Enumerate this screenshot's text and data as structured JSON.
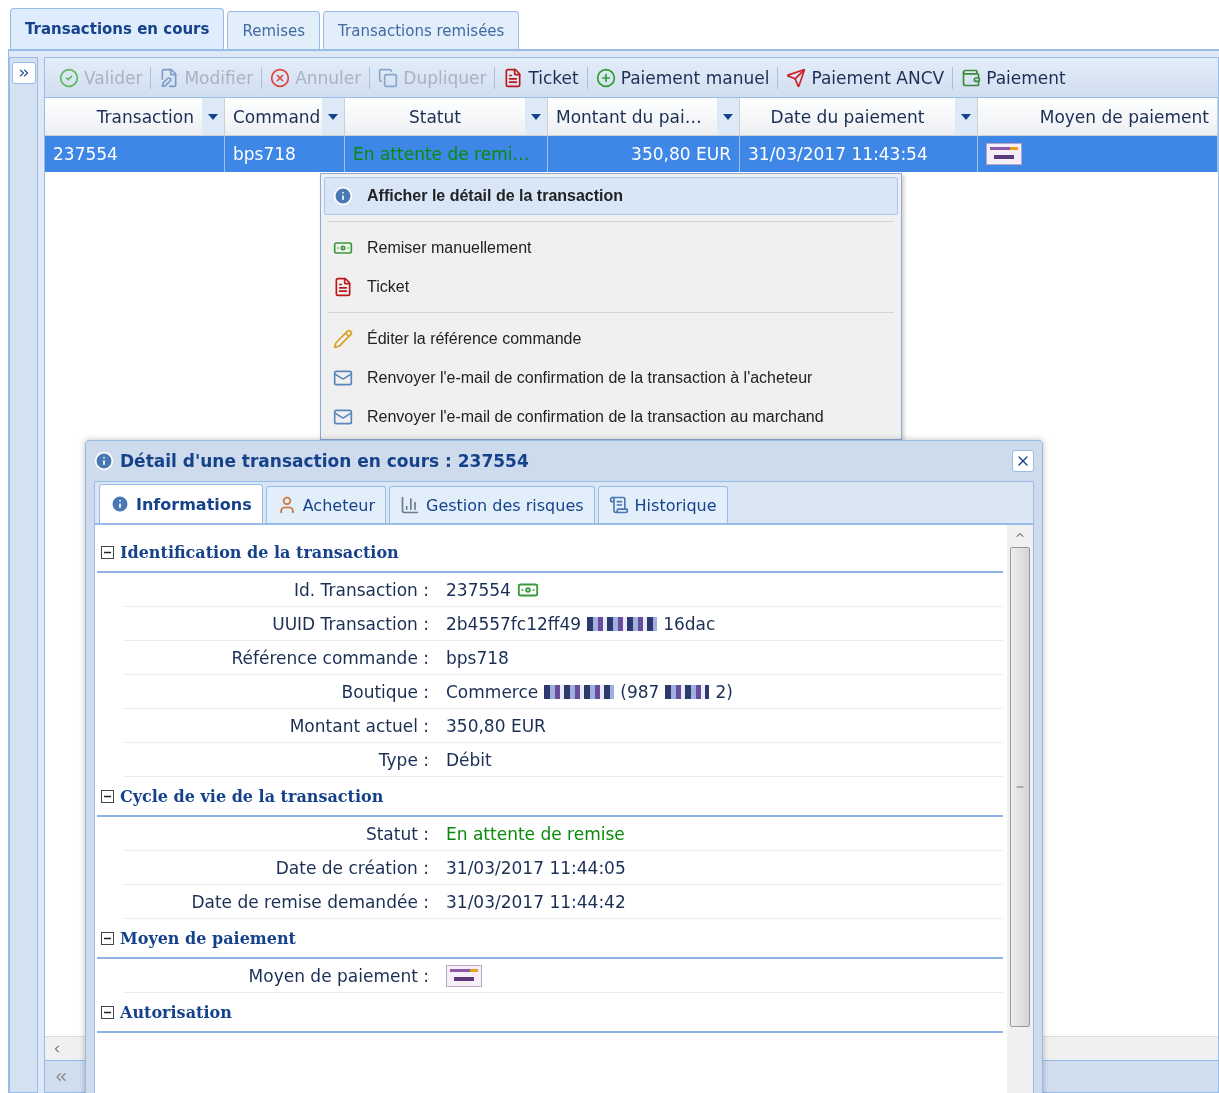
{
  "tabs": [
    {
      "label": "Transactions en cours",
      "selected": true
    },
    {
      "label": "Remises",
      "selected": false
    },
    {
      "label": "Transactions remisées",
      "selected": false
    }
  ],
  "toolbar": [
    {
      "label": "Valider",
      "disabled": true
    },
    {
      "label": "Modifier",
      "disabled": true
    },
    {
      "label": "Annuler",
      "disabled": true
    },
    {
      "label": "Dupliquer",
      "disabled": true
    },
    {
      "label": "Ticket",
      "disabled": false
    },
    {
      "label": "Paiement manuel",
      "disabled": false
    },
    {
      "label": "Paiement ANCV",
      "disabled": false
    },
    {
      "label": "Paiement",
      "disabled": false
    }
  ],
  "grid": {
    "columns": [
      "Transaction",
      "Command",
      "Statut",
      "Montant du pai…",
      "Date du paiement",
      "Moyen de paiement"
    ],
    "rows": [
      {
        "selected": true,
        "cells": [
          {
            "kind": "text",
            "text": "237554"
          },
          {
            "kind": "text",
            "text": "bps718"
          },
          {
            "kind": "status",
            "text": "En attente de remi…"
          },
          {
            "kind": "amount",
            "text": "350,80 EUR"
          },
          {
            "kind": "text",
            "text": "31/03/2017 11:43:54"
          },
          {
            "kind": "logo"
          }
        ]
      }
    ]
  },
  "context_menu": [
    [
      {
        "label": "Afficher le détail de la transaction",
        "highlighted": true
      }
    ],
    [
      {
        "label": "Remiser manuellement",
        "highlighted": false
      },
      {
        "label": "Ticket",
        "highlighted": false
      }
    ],
    [
      {
        "label": "Éditer la référence commande",
        "highlighted": false
      },
      {
        "label": "Renvoyer l'e-mail de confirmation de la transaction à l'acheteur",
        "highlighted": false
      },
      {
        "label": "Renvoyer l'e-mail de confirmation de la transaction au marchand",
        "highlighted": false
      }
    ]
  ],
  "detail_window": {
    "title": "Détail d'une transaction en cours : 237554",
    "tabs": [
      {
        "label": "Informations",
        "selected": true
      },
      {
        "label": "Acheteur",
        "selected": false
      },
      {
        "label": "Gestion des risques",
        "selected": false
      },
      {
        "label": "Historique",
        "selected": false
      }
    ],
    "sections": [
      {
        "title": "Identification de la transaction",
        "expanded": true,
        "rows": [
          {
            "label": "Id. Transaction :",
            "kind": "with_icon",
            "parts": [
              "237554"
            ]
          },
          {
            "label": "UUID Transaction :",
            "kind": "redacted",
            "parts": [
              "2b4557fc12ff49",
              "16dac"
            ]
          },
          {
            "label": "Référence commande :",
            "kind": "text",
            "parts": [
              "bps718"
            ]
          },
          {
            "label": "Boutique :",
            "kind": "redacted",
            "parts": [
              "Commerce",
              "(987",
              "2)"
            ]
          },
          {
            "label": "Montant actuel :",
            "kind": "text",
            "parts": [
              "350,80 EUR"
            ]
          },
          {
            "label": "Type :",
            "kind": "text",
            "parts": [
              "Débit"
            ]
          }
        ]
      },
      {
        "title": "Cycle de vie de la transaction",
        "expanded": true,
        "rows": [
          {
            "label": "Statut :",
            "kind": "status",
            "parts": [
              "En attente de remise"
            ]
          },
          {
            "label": "Date de création :",
            "kind": "text",
            "parts": [
              "31/03/2017 11:44:05"
            ]
          },
          {
            "label": "Date de remise demandée :",
            "kind": "text",
            "parts": [
              "31/03/2017 11:44:42"
            ]
          }
        ]
      },
      {
        "title": "Moyen de paiement",
        "expanded": true,
        "rows": [
          {
            "label": "Moyen de paiement :",
            "kind": "logo"
          }
        ]
      },
      {
        "title": "Autorisation",
        "expanded": true
      }
    ]
  }
}
